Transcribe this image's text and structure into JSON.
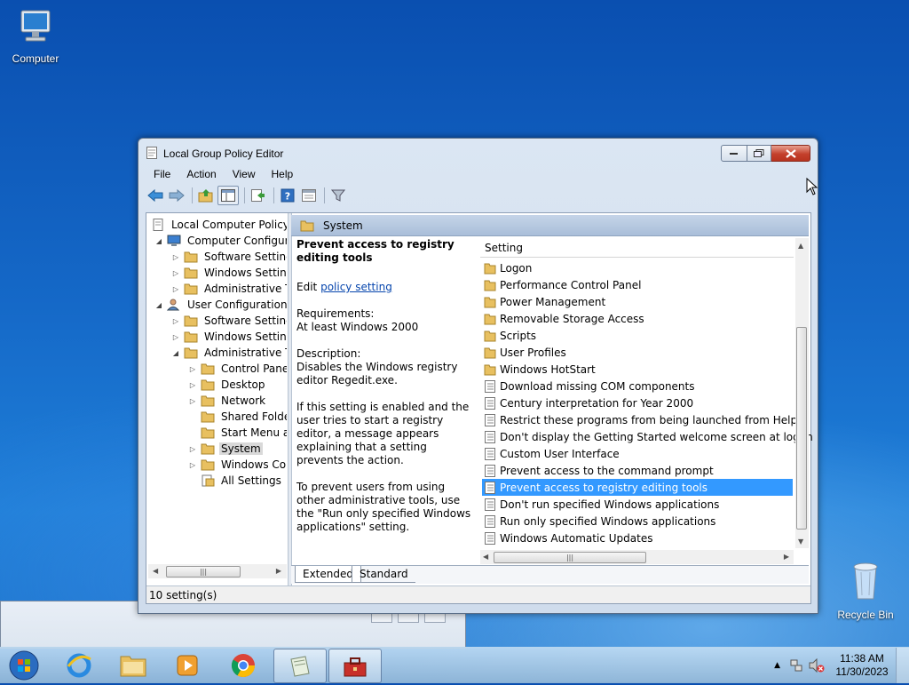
{
  "desktop": {
    "icons": [
      {
        "label": "Computer"
      },
      {
        "label": "Recycle Bin"
      }
    ]
  },
  "window": {
    "title": "Local Group Policy Editor",
    "menu": [
      "File",
      "Action",
      "View",
      "Help"
    ],
    "tree": [
      {
        "label": "Local Computer Policy",
        "icon": "policy-icon"
      },
      {
        "label": "Computer Configura",
        "icon": "computer-icon"
      },
      {
        "label": "Software Settings",
        "icon": "folder-icon"
      },
      {
        "label": "Windows Setting",
        "icon": "folder-icon"
      },
      {
        "label": "Administrative Te",
        "icon": "folder-icon"
      },
      {
        "label": "User Configuration",
        "icon": "user-icon"
      },
      {
        "label": "Software Settings",
        "icon": "folder-icon"
      },
      {
        "label": "Windows Setting",
        "icon": "folder-icon"
      },
      {
        "label": "Administrative Te",
        "icon": "folder-icon"
      },
      {
        "label": "Control Panel",
        "icon": "folder-icon"
      },
      {
        "label": "Desktop",
        "icon": "folder-icon"
      },
      {
        "label": "Network",
        "icon": "folder-icon"
      },
      {
        "label": "Shared Folder",
        "icon": "folder-icon"
      },
      {
        "label": "Start Menu ar",
        "icon": "folder-icon"
      },
      {
        "label": "System",
        "icon": "folder-icon"
      },
      {
        "label": "Windows Cor",
        "icon": "folder-icon"
      },
      {
        "label": "All Settings",
        "icon": "settings-icon"
      }
    ],
    "pane_header": "System",
    "description": {
      "heading": "Prevent access to registry editing tools",
      "edit_prefix": "Edit",
      "edit_link": "policy setting",
      "requirements_label": "Requirements:",
      "requirements_value": "At least Windows 2000",
      "description_label": "Description:",
      "description_text": "Disables the Windows registry editor Regedit.exe.",
      "para1": "If this setting is enabled and the user tries to start a registry editor, a message appears explaining that a setting prevents the action.",
      "para2": "To prevent users from using other administrative tools, use the \"Run only specified Windows applications\" setting."
    },
    "list": {
      "column": "Setting",
      "rows": [
        {
          "label": "Logon",
          "type": "folder"
        },
        {
          "label": "Performance Control Panel",
          "type": "folder"
        },
        {
          "label": "Power Management",
          "type": "folder"
        },
        {
          "label": "Removable Storage Access",
          "type": "folder"
        },
        {
          "label": "Scripts",
          "type": "folder"
        },
        {
          "label": "User Profiles",
          "type": "folder"
        },
        {
          "label": "Windows HotStart",
          "type": "folder"
        },
        {
          "label": "Download missing COM components",
          "type": "setting"
        },
        {
          "label": "Century interpretation for Year 2000",
          "type": "setting"
        },
        {
          "label": "Restrict these programs from being launched from Help",
          "type": "setting"
        },
        {
          "label": "Don't display the Getting Started welcome screen at logon",
          "type": "setting"
        },
        {
          "label": "Custom User Interface",
          "type": "setting"
        },
        {
          "label": "Prevent access to the command prompt",
          "type": "setting"
        },
        {
          "label": "Prevent access to registry editing tools",
          "type": "setting",
          "selected": true
        },
        {
          "label": "Don't run specified Windows applications",
          "type": "setting"
        },
        {
          "label": "Run only specified Windows applications",
          "type": "setting"
        },
        {
          "label": "Windows Automatic Updates",
          "type": "setting"
        }
      ]
    },
    "tabs": [
      "Extended",
      "Standard"
    ],
    "status": "10 setting(s)"
  },
  "taskbar": {
    "time": "11:38 AM",
    "date": "11/30/2023"
  },
  "colors": {
    "selection": "#3399ff",
    "link": "#0645ad",
    "folder": "#e8c060"
  }
}
